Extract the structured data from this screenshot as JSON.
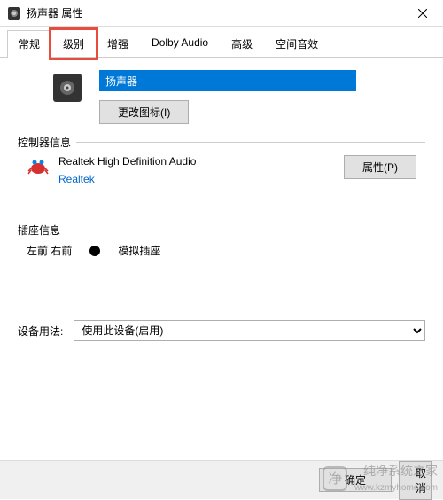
{
  "window": {
    "title": "扬声器 属性"
  },
  "tabs": [
    {
      "label": "常规",
      "active": true
    },
    {
      "label": "级别",
      "highlighted": true
    },
    {
      "label": "增强"
    },
    {
      "label": "Dolby Audio"
    },
    {
      "label": "高级"
    },
    {
      "label": "空间音效"
    }
  ],
  "device": {
    "name": "扬声器",
    "change_icon_label": "更改图标(I)"
  },
  "controller": {
    "section_label": "控制器信息",
    "name": "Realtek High Definition Audio",
    "vendor": "Realtek",
    "properties_label": "属性(P)"
  },
  "jack": {
    "section_label": "插座信息",
    "position": "左前 右前",
    "type": "模拟插座"
  },
  "usage": {
    "label": "设备用法:",
    "selected": "使用此设备(启用)"
  },
  "buttons": {
    "ok": "确定",
    "cancel": "取消"
  },
  "watermark": {
    "name": "纯净系统之家",
    "url": "www.kzmyhome.com"
  }
}
